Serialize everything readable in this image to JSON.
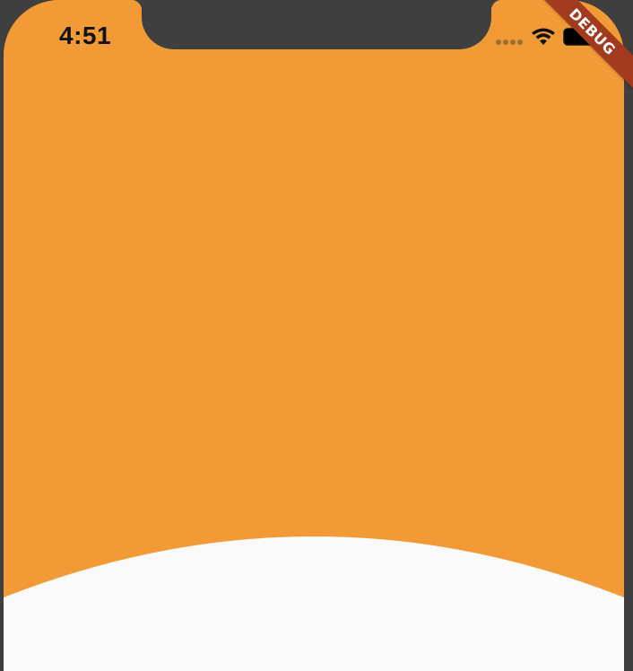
{
  "status_bar": {
    "time": "4:51",
    "signal_icon": "signal-dots-icon",
    "wifi_icon": "wifi-icon",
    "battery_icon": "battery-icon"
  },
  "debug_banner": {
    "label": "DEBUG"
  },
  "colors": {
    "header": "#f29b36",
    "body": "#fafafa",
    "frame": "#3f3f3f",
    "ribbon": "#a23a1d"
  }
}
